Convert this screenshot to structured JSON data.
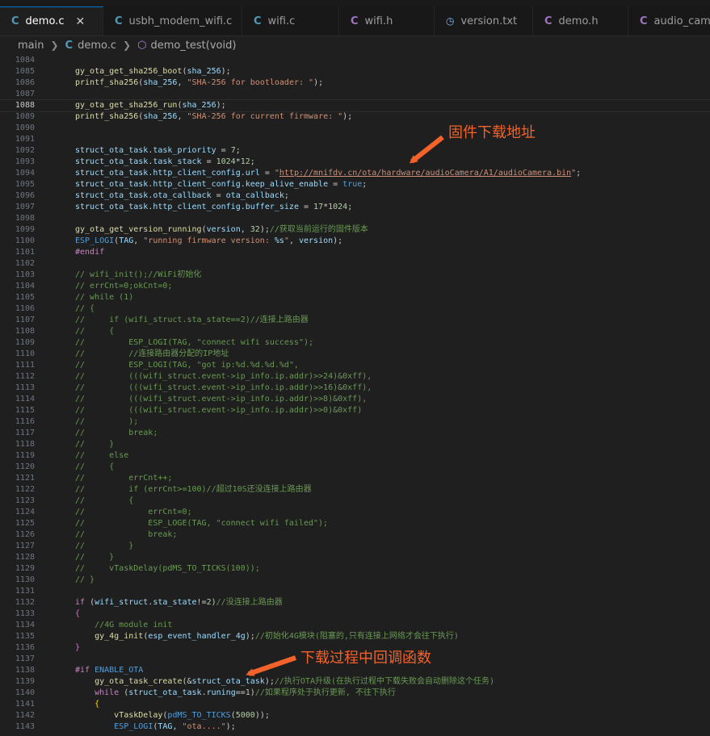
{
  "tabs": [
    {
      "label": "demo.c",
      "type": "c",
      "active": true
    },
    {
      "label": "usbh_modem_wifi.c",
      "type": "c"
    },
    {
      "label": "wifi.c",
      "type": "c"
    },
    {
      "label": "wifi.h",
      "type": "h"
    },
    {
      "label": "version.txt",
      "type": "txt"
    },
    {
      "label": "demo.h",
      "type": "c"
    },
    {
      "label": "audio_came",
      "type": "c"
    }
  ],
  "icons": {
    "c": "C",
    "h": "C",
    "close": "✕"
  },
  "breadcrumb": {
    "folder": "main",
    "file": "demo.c",
    "symbol": "demo_test(void)"
  },
  "annotations": {
    "firmware_url": "固件下载地址",
    "callback": "下载过程中回调函数"
  },
  "colors": {
    "annotation": "#f3622a",
    "accent": "#0078d4"
  },
  "code_lines": [
    {
      "n": "1084",
      "t": []
    },
    {
      "n": "1085",
      "t": [
        [
          "    ",
          "p"
        ],
        [
          "gy_ota_get_sha256_boot",
          "fn"
        ],
        [
          "(",
          "p"
        ],
        [
          "sha_256",
          "var"
        ],
        [
          ");",
          "p"
        ]
      ]
    },
    {
      "n": "1086",
      "t": [
        [
          "    ",
          "p"
        ],
        [
          "printf_sha256",
          "fn"
        ],
        [
          "(",
          "p"
        ],
        [
          "sha_256",
          "var"
        ],
        [
          ", ",
          "p"
        ],
        [
          "\"SHA-256 for bootloader: \"",
          "str"
        ],
        [
          ");",
          "p"
        ]
      ]
    },
    {
      "n": "1087",
      "t": []
    },
    {
      "n": "1088",
      "t": [
        [
          "    ",
          "p"
        ],
        [
          "gy_ota_get_sha256_run",
          "fn"
        ],
        [
          "(",
          "p"
        ],
        [
          "sha_256",
          "var"
        ],
        [
          ");",
          "p"
        ]
      ]
    },
    {
      "n": "1089",
      "t": [
        [
          "    ",
          "p"
        ],
        [
          "printf_sha256",
          "fn"
        ],
        [
          "(",
          "p"
        ],
        [
          "sha_256",
          "var"
        ],
        [
          ", ",
          "p"
        ],
        [
          "\"SHA-256 for current firmware: \"",
          "str"
        ],
        [
          ");",
          "p"
        ]
      ]
    },
    {
      "n": "1090",
      "t": []
    },
    {
      "n": "1091",
      "t": []
    },
    {
      "n": "1092",
      "t": [
        [
          "    ",
          "p"
        ],
        [
          "struct_ota_task",
          "var"
        ],
        [
          ".",
          "p"
        ],
        [
          "task_priority",
          "var"
        ],
        [
          " = ",
          "p"
        ],
        [
          "7",
          "num"
        ],
        [
          ";",
          "p"
        ]
      ]
    },
    {
      "n": "1093",
      "t": [
        [
          "    ",
          "p"
        ],
        [
          "struct_ota_task",
          "var"
        ],
        [
          ".",
          "p"
        ],
        [
          "task_stack",
          "var"
        ],
        [
          " = ",
          "p"
        ],
        [
          "1024",
          "num"
        ],
        [
          "*",
          "p"
        ],
        [
          "12",
          "num"
        ],
        [
          ";",
          "p"
        ]
      ]
    },
    {
      "n": "1094",
      "t": [
        [
          "    ",
          "p"
        ],
        [
          "struct_ota_task",
          "var"
        ],
        [
          ".",
          "p"
        ],
        [
          "http_client_config",
          "var"
        ],
        [
          ".",
          "p"
        ],
        [
          "url",
          "var"
        ],
        [
          " = ",
          "p"
        ],
        [
          "\"",
          "str"
        ],
        [
          "http://mnifdv.cn/ota/hardware/audioCamera/A1/audioCamera.bin",
          "url"
        ],
        [
          "\"",
          "str"
        ],
        [
          ";",
          "p"
        ]
      ]
    },
    {
      "n": "1095",
      "t": [
        [
          "    ",
          "p"
        ],
        [
          "struct_ota_task",
          "var"
        ],
        [
          ".",
          "p"
        ],
        [
          "http_client_config",
          "var"
        ],
        [
          ".",
          "p"
        ],
        [
          "keep_alive_enable",
          "var"
        ],
        [
          " = ",
          "p"
        ],
        [
          "true",
          "bool"
        ],
        [
          ";",
          "p"
        ]
      ]
    },
    {
      "n": "1096",
      "t": [
        [
          "    ",
          "p"
        ],
        [
          "struct_ota_task",
          "var"
        ],
        [
          ".",
          "p"
        ],
        [
          "ota_callback",
          "var"
        ],
        [
          " = ",
          "p"
        ],
        [
          "ota_callback",
          "var"
        ],
        [
          ";",
          "p"
        ]
      ]
    },
    {
      "n": "1097",
      "t": [
        [
          "    ",
          "p"
        ],
        [
          "struct_ota_task",
          "var"
        ],
        [
          ".",
          "p"
        ],
        [
          "http_client_config",
          "var"
        ],
        [
          ".",
          "p"
        ],
        [
          "buffer_size",
          "var"
        ],
        [
          " = ",
          "p"
        ],
        [
          "17",
          "num"
        ],
        [
          "*",
          "p"
        ],
        [
          "1024",
          "num"
        ],
        [
          ";",
          "p"
        ]
      ]
    },
    {
      "n": "1098",
      "t": []
    },
    {
      "n": "1099",
      "t": [
        [
          "    ",
          "p"
        ],
        [
          "gy_ota_get_version_running",
          "fn"
        ],
        [
          "(",
          "p"
        ],
        [
          "version",
          "var"
        ],
        [
          ", ",
          "p"
        ],
        [
          "32",
          "num"
        ],
        [
          ");",
          "p"
        ],
        [
          "//获取当前运行的固件版本",
          "cm"
        ]
      ]
    },
    {
      "n": "1100",
      "t": [
        [
          "    ",
          "p"
        ],
        [
          "ESP_LOGI",
          "mac"
        ],
        [
          "(",
          "p"
        ],
        [
          "TAG",
          "var"
        ],
        [
          ", ",
          "p"
        ],
        [
          "\"running firmware version: ",
          "str"
        ],
        [
          "%s",
          "var"
        ],
        [
          "\"",
          "str"
        ],
        [
          ", ",
          "p"
        ],
        [
          "version",
          "var"
        ],
        [
          ");",
          "p"
        ]
      ]
    },
    {
      "n": "1101",
      "t": [
        [
          "    ",
          "p"
        ],
        [
          "#endif",
          "pp"
        ]
      ]
    },
    {
      "n": "1102",
      "t": []
    },
    {
      "n": "1103",
      "t": [
        [
          "    // wifi_init();//WiFi初始化",
          "cm"
        ]
      ]
    },
    {
      "n": "1104",
      "t": [
        [
          "    // errCnt=0;okCnt=0;",
          "cm"
        ]
      ]
    },
    {
      "n": "1105",
      "t": [
        [
          "    // while (1)",
          "cm"
        ]
      ]
    },
    {
      "n": "1106",
      "t": [
        [
          "    // {",
          "cm"
        ]
      ]
    },
    {
      "n": "1107",
      "t": [
        [
          "    //     if (wifi_struct.sta_state==2)//连接上路由器",
          "cm"
        ]
      ]
    },
    {
      "n": "1108",
      "t": [
        [
          "    //     {",
          "cm"
        ]
      ]
    },
    {
      "n": "1109",
      "t": [
        [
          "    //         ESP_LOGI(TAG, \"connect wifi success\");",
          "cm"
        ]
      ]
    },
    {
      "n": "1110",
      "t": [
        [
          "    //         //连接路由器分配的IP地址",
          "cm"
        ]
      ]
    },
    {
      "n": "1111",
      "t": [
        [
          "    //         ESP_LOGI(TAG, \"got ip:%d.%d.%d.%d\",",
          "cm"
        ]
      ]
    },
    {
      "n": "1112",
      "t": [
        [
          "    //         (((wifi_struct.event->ip_info.ip.addr)>>24)&0xff),",
          "cm"
        ]
      ]
    },
    {
      "n": "1113",
      "t": [
        [
          "    //         (((wifi_struct.event->ip_info.ip.addr)>>16)&0xff),",
          "cm"
        ]
      ]
    },
    {
      "n": "1114",
      "t": [
        [
          "    //         (((wifi_struct.event->ip_info.ip.addr)>>8)&0xff),",
          "cm"
        ]
      ]
    },
    {
      "n": "1115",
      "t": [
        [
          "    //         (((wifi_struct.event->ip_info.ip.addr)>>0)&0xff)",
          "cm"
        ]
      ]
    },
    {
      "n": "1116",
      "t": [
        [
          "    //         );",
          "cm"
        ]
      ]
    },
    {
      "n": "1117",
      "t": [
        [
          "    //         break;",
          "cm"
        ]
      ]
    },
    {
      "n": "1118",
      "t": [
        [
          "    //     }",
          "cm"
        ]
      ]
    },
    {
      "n": "1119",
      "t": [
        [
          "    //     else",
          "cm"
        ]
      ]
    },
    {
      "n": "1120",
      "t": [
        [
          "    //     {",
          "cm"
        ]
      ]
    },
    {
      "n": "1121",
      "t": [
        [
          "    //         errCnt++;",
          "cm"
        ]
      ]
    },
    {
      "n": "1122",
      "t": [
        [
          "    //         if (errCnt>=100)//超过10S还没连接上路由器",
          "cm"
        ]
      ]
    },
    {
      "n": "1123",
      "t": [
        [
          "    //         {",
          "cm"
        ]
      ]
    },
    {
      "n": "1124",
      "t": [
        [
          "    //             errCnt=0;",
          "cm"
        ]
      ]
    },
    {
      "n": "1125",
      "t": [
        [
          "    //             ESP_LOGE(TAG, \"connect wifi failed\");",
          "cm"
        ]
      ]
    },
    {
      "n": "1126",
      "t": [
        [
          "    //             break;",
          "cm"
        ]
      ]
    },
    {
      "n": "1127",
      "t": [
        [
          "    //         }",
          "cm"
        ]
      ]
    },
    {
      "n": "1128",
      "t": [
        [
          "    //     }",
          "cm"
        ]
      ]
    },
    {
      "n": "1129",
      "t": [
        [
          "    //     vTaskDelay(pdMS_TO_TICKS(100));",
          "cm"
        ]
      ]
    },
    {
      "n": "1130",
      "t": [
        [
          "    // }",
          "cm"
        ]
      ]
    },
    {
      "n": "1131",
      "t": []
    },
    {
      "n": "1132",
      "t": [
        [
          "    ",
          "p"
        ],
        [
          "if",
          "kw"
        ],
        [
          " (",
          "p"
        ],
        [
          "wifi_struct",
          "var"
        ],
        [
          ".",
          "p"
        ],
        [
          "sta_state",
          "var"
        ],
        [
          "!=",
          "p"
        ],
        [
          "2",
          "num"
        ],
        [
          ")",
          "p"
        ],
        [
          "//没连接上路由器",
          "cm"
        ]
      ]
    },
    {
      "n": "1133",
      "t": [
        [
          "    ",
          "p"
        ],
        [
          "{",
          "brace"
        ]
      ]
    },
    {
      "n": "1134",
      "t": [
        [
          "        //4G module init",
          "cm"
        ]
      ]
    },
    {
      "n": "1135",
      "t": [
        [
          "        ",
          "p"
        ],
        [
          "gy_4g_init",
          "fn"
        ],
        [
          "(",
          "p"
        ],
        [
          "esp_event_handler_4g",
          "var"
        ],
        [
          ");",
          "p"
        ],
        [
          "//初始化4G模块(阻塞的,只有连接上网络才会往下执行)",
          "cm"
        ]
      ]
    },
    {
      "n": "1136",
      "t": [
        [
          "    ",
          "p"
        ],
        [
          "}",
          "brace"
        ]
      ]
    },
    {
      "n": "1137",
      "t": []
    },
    {
      "n": "1138",
      "t": [
        [
          "    ",
          "p"
        ],
        [
          "#if",
          "pp"
        ],
        [
          " ",
          "p"
        ],
        [
          "ENABLE_OTA",
          "mac"
        ]
      ]
    },
    {
      "n": "1139",
      "t": [
        [
          "        ",
          "p"
        ],
        [
          "gy_ota_task_create",
          "fn"
        ],
        [
          "(&",
          "p"
        ],
        [
          "struct_ota_task",
          "var"
        ],
        [
          ");",
          "p"
        ],
        [
          "//执行OTA升级(在执行过程中下载失败会自动删除这个任务)",
          "cm"
        ]
      ]
    },
    {
      "n": "1140",
      "t": [
        [
          "        ",
          "p"
        ],
        [
          "while",
          "kw"
        ],
        [
          " (",
          "p"
        ],
        [
          "struct_ota_task",
          "var"
        ],
        [
          ".",
          "p"
        ],
        [
          "runing",
          "var"
        ],
        [
          "==",
          "p"
        ],
        [
          "1",
          "num"
        ],
        [
          ")",
          "p"
        ],
        [
          "//如果程序处于执行更新, 不往下执行",
          "cm"
        ]
      ]
    },
    {
      "n": "1141",
      "t": [
        [
          "        ",
          "p"
        ],
        [
          "{",
          "brace2"
        ]
      ]
    },
    {
      "n": "1142",
      "t": [
        [
          "            ",
          "p"
        ],
        [
          "vTaskDelay",
          "fn"
        ],
        [
          "(",
          "p"
        ],
        [
          "pdMS_TO_TICKS",
          "mac"
        ],
        [
          "(",
          "p"
        ],
        [
          "5000",
          "num"
        ],
        [
          "));",
          "p"
        ]
      ]
    },
    {
      "n": "1143",
      "t": [
        [
          "            ",
          "p"
        ],
        [
          "ESP_LOGI",
          "mac"
        ],
        [
          "(",
          "p"
        ],
        [
          "TAG",
          "var"
        ],
        [
          ", ",
          "p"
        ],
        [
          "\"ota....\"",
          "str"
        ],
        [
          ");",
          "p"
        ]
      ]
    }
  ]
}
